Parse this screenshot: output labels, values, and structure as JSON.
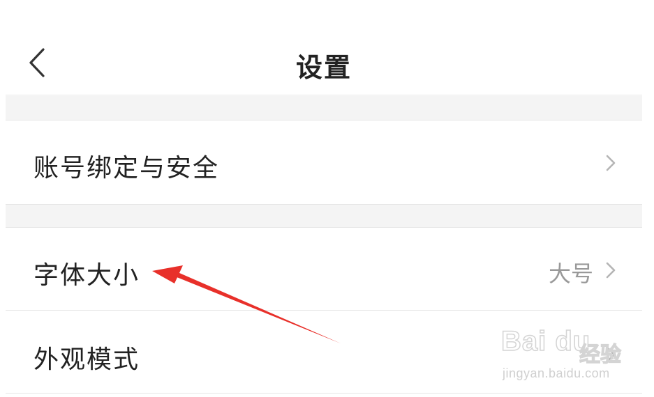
{
  "header": {
    "title": "设置",
    "back_icon": "chevron-left-icon"
  },
  "settings": {
    "items": [
      {
        "label": "账号绑定与安全",
        "value": "",
        "icon": "chevron-right-icon"
      },
      {
        "label": "字体大小",
        "value": "大号",
        "icon": "chevron-right-icon"
      },
      {
        "label": "外观模式",
        "value": "",
        "icon": "chevron-right-icon"
      }
    ]
  },
  "annotation": {
    "color": "#e8302a"
  },
  "watermark": {
    "brand": "Bai du",
    "brand_cn": "经验",
    "url": "jingyan.baidu.com"
  },
  "colors": {
    "background": "#ffffff",
    "divider": "#e6e6e6",
    "section_gap": "#f4f4f4",
    "text_primary": "#222222",
    "text_secondary": "#999999",
    "chevron": "#bbbbbb"
  }
}
